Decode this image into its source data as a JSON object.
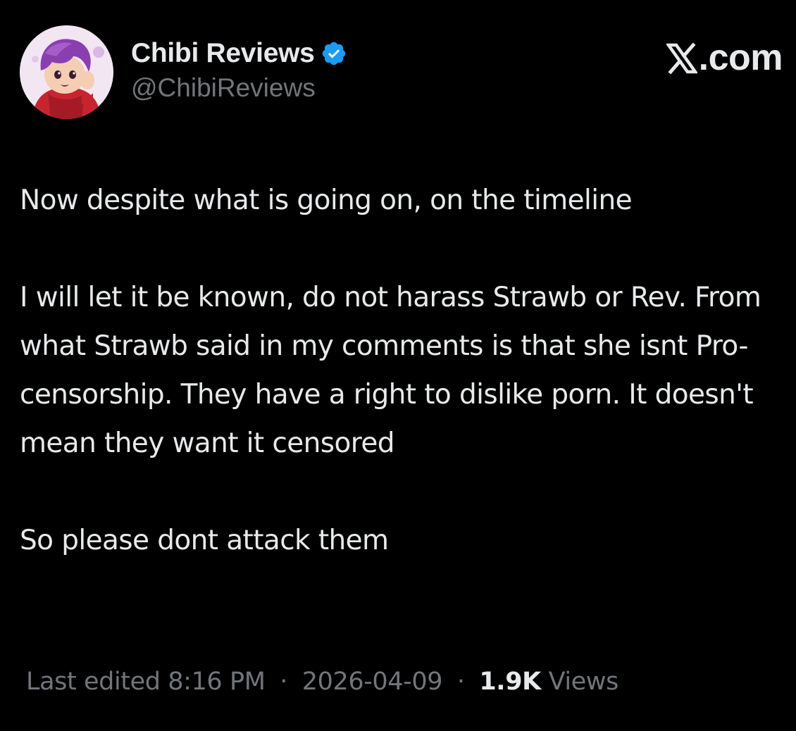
{
  "author": {
    "display_name": "Chibi Reviews",
    "handle": "@ChibiReviews",
    "verified": true,
    "verified_color": "#1d9bf0"
  },
  "site": {
    "logo_text": ".com",
    "logo_icon": "x-logo-icon"
  },
  "tweet": {
    "paragraphs": [
      "Now despite what is going on, on the timeline",
      "I will let it be known, do not harass Strawb or Rev. From what Strawb said in my comments is that she isnt Pro-censorship. They have a right to dislike porn. It doesn't mean they want it censored",
      "So please dont attack them"
    ]
  },
  "meta": {
    "edited_label": "Last edited 8:16 PM",
    "separator": "·",
    "date": "2026-04-09",
    "views_count": "1.9K",
    "views_label": "Views"
  },
  "colors": {
    "background": "#000000",
    "primary_text": "#e7e9ea",
    "secondary_text": "#71767b"
  }
}
